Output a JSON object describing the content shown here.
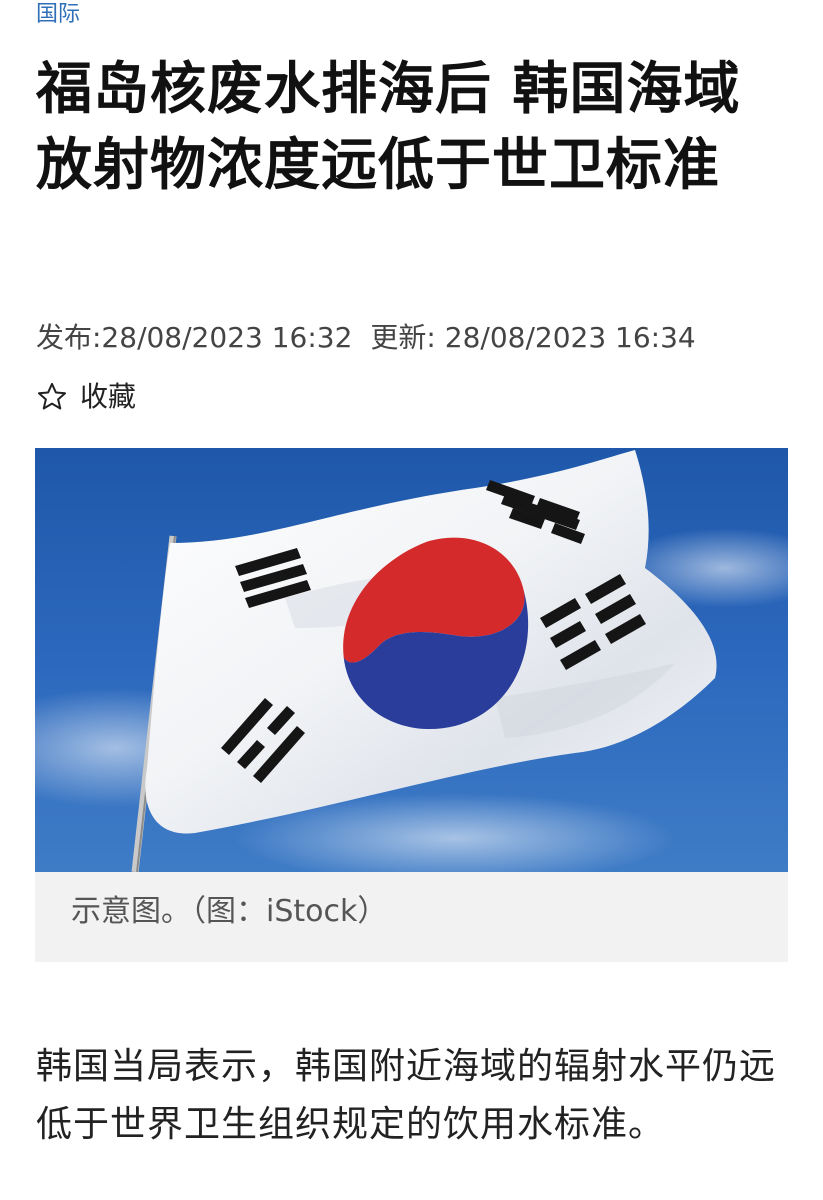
{
  "category": {
    "label": "国际"
  },
  "article": {
    "title": "福岛核废水排海后 韩国海域放射物浓度远低于世卫标准",
    "published": "发布:28/08/2023 16:32",
    "updated": "更新: 28/08/2023 16:34",
    "favorite_label": "收藏",
    "favorite_icon": "star-outline-icon",
    "image": {
      "subject": "korean-flag",
      "caption": "示意图。（图：iStock）"
    },
    "body": "韩国当局表示，韩国附近海域的辐射水平仍远低于世界卫生组织规定的饮用水标准。"
  },
  "colors": {
    "category": "#2f6fb8",
    "sky": "#2a63b6",
    "flag_red": "#d42a2c",
    "flag_blue": "#2a3d9a",
    "caption_bg": "#f2f2f2"
  }
}
